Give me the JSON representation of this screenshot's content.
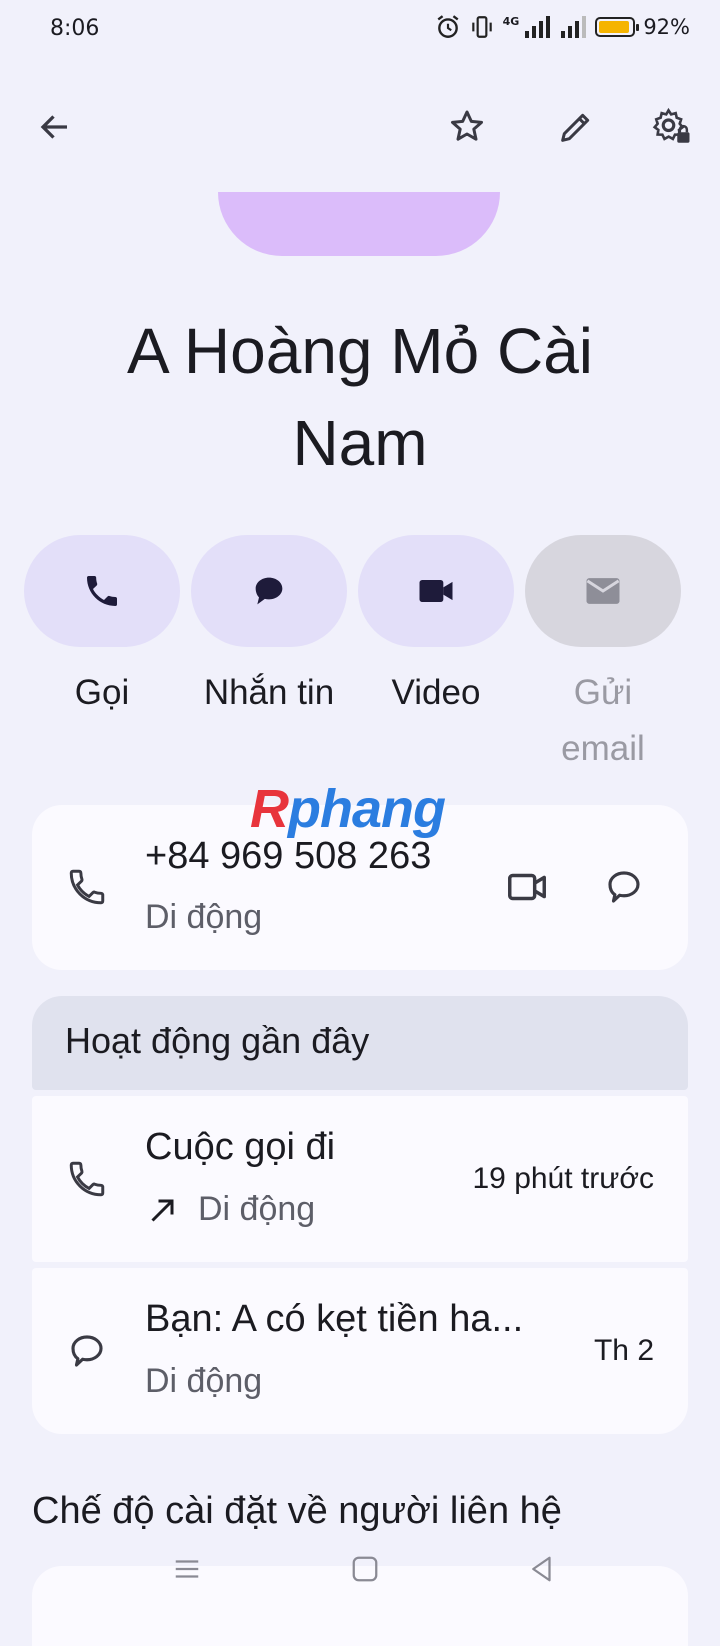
{
  "status_bar": {
    "time": "8:06",
    "network": "4G",
    "battery_percent": "92%",
    "battery_level": 0.92,
    "icons": [
      "alarm-icon",
      "vibrate-icon",
      "signal-icon",
      "battery-icon"
    ]
  },
  "app_bar": {
    "icons": [
      "back-arrow-icon",
      "star-icon",
      "edit-pencil-icon",
      "settings-gear-icon"
    ]
  },
  "contact": {
    "name": "A Hoàng Mỏ Cài Nam",
    "name_line1": "A Hoàng Mỏ Cài",
    "name_line2": "Nam",
    "avatar_color": "#dbbcfa"
  },
  "actions": [
    {
      "label": "Gọi",
      "icon": "phone-icon",
      "enabled": true
    },
    {
      "label": "Nhắn tin",
      "icon": "message-icon",
      "enabled": true
    },
    {
      "label": "Video",
      "icon": "video-icon",
      "enabled": true
    },
    {
      "label": "Gửi email",
      "label_line1": "Gửi",
      "label_line2": "email",
      "icon": "mail-icon",
      "enabled": false
    }
  ],
  "watermark": {
    "part1": "R",
    "part2": "phang"
  },
  "phone": {
    "number": "+84 969 508 263",
    "type": "Di động"
  },
  "recent": {
    "title": "Hoạt động gần đây",
    "items": [
      {
        "title": "Cuộc gọi đi",
        "subtitle": "Di động",
        "time": "19 phút trước",
        "icon": "phone-icon",
        "direction_icon": "outgoing-arrow-icon"
      },
      {
        "title": "Bạn: A có kẹt tiền ha...",
        "subtitle": "Di động",
        "time": "Th 2",
        "icon": "message-bubble-icon"
      }
    ]
  },
  "settings": {
    "title": "Chế độ cài đặt về người liên hệ"
  },
  "colors": {
    "background": "#f1f1fb",
    "accent_pill": "#e3dff9",
    "disabled_pill": "#d7d6de",
    "battery": "#f5b400"
  }
}
